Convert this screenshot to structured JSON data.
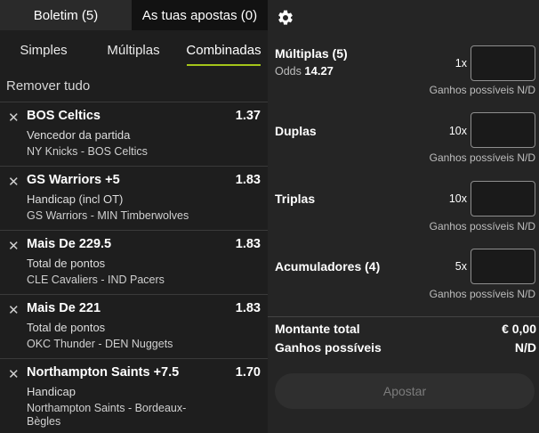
{
  "tabs": {
    "betslip": "Boletim (5)",
    "my_bets": "As tuas apostas (0)"
  },
  "subtabs": {
    "singles": "Simples",
    "multiples": "Múltiplas",
    "combined": "Combinadas"
  },
  "remove_all": "Remover tudo",
  "selections": [
    {
      "name": "BOS Celtics",
      "odd": "1.37",
      "market": "Vencedor da partida",
      "event": "NY Knicks - BOS Celtics"
    },
    {
      "name": "GS Warriors +5",
      "odd": "1.83",
      "market": "Handicap (incl OT)",
      "event": "GS Warriors - MIN Timberwolves"
    },
    {
      "name": "Mais De 229.5",
      "odd": "1.83",
      "market": "Total de pontos",
      "event": "CLE Cavaliers - IND Pacers"
    },
    {
      "name": "Mais De 221",
      "odd": "1.83",
      "market": "Total de pontos",
      "event": "OKC Thunder - DEN Nuggets"
    },
    {
      "name": "Northampton Saints +7.5",
      "odd": "1.70",
      "market": "Handicap",
      "event": "Northampton Saints - Bordeaux-Bègles"
    }
  ],
  "settings_icon": "gear-icon",
  "combos": [
    {
      "name": "Múltiplas (5)",
      "odds_label": "Odds",
      "odds_value": "14.27",
      "multiplier": "1x",
      "gains": "Ganhos possíveis N/D"
    },
    {
      "name": "Duplas",
      "multiplier": "10x",
      "gains": "Ganhos possíveis N/D"
    },
    {
      "name": "Triplas",
      "multiplier": "10x",
      "gains": "Ganhos possíveis N/D"
    },
    {
      "name": "Acumuladores (4)",
      "multiplier": "5x",
      "gains": "Ganhos possíveis N/D"
    }
  ],
  "summary": {
    "total_label": "Montante total",
    "total_value": "€ 0,00",
    "gains_label": "Ganhos possíveis",
    "gains_value": "N/D"
  },
  "place_bet": "Apostar",
  "colors": {
    "accent": "#a4c41a"
  }
}
